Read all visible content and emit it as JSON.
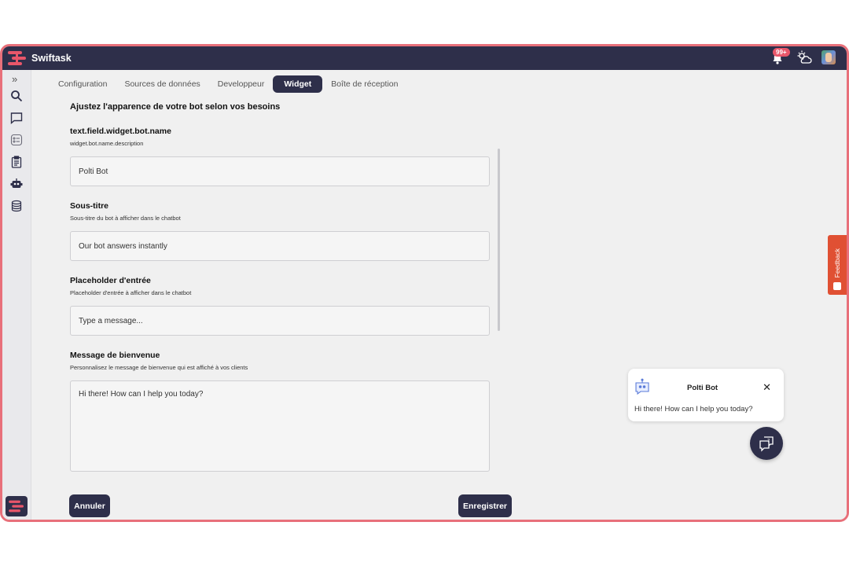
{
  "app": {
    "name": "Swiftask",
    "notification_count": "99+"
  },
  "colors": {
    "primary": "#2e2f4a",
    "accent": "#e8566a",
    "feedback": "#e05033",
    "frame": "#e8707a"
  },
  "sidebar": {
    "expand_glyph": "»",
    "icons": [
      "search-icon",
      "chat-icon",
      "checklist-icon",
      "clipboard-icon",
      "robot-icon",
      "database-icon"
    ]
  },
  "tabs": [
    {
      "label": "Configuration",
      "active": false
    },
    {
      "label": "Sources de données",
      "active": false
    },
    {
      "label": "Developpeur",
      "active": false
    },
    {
      "label": "Widget",
      "active": true
    },
    {
      "label": "Boîte de réception",
      "active": false
    }
  ],
  "form": {
    "title": "Ajustez l'apparence de votre bot selon vos besoins",
    "fields": [
      {
        "label": "text.field.widget.bot.name",
        "description": "widget.bot.name.description",
        "value": "Polti Bot"
      },
      {
        "label": "Sous-titre",
        "description": "Sous-titre du bot à afficher dans le chatbot",
        "value": "Our bot answers instantly"
      },
      {
        "label": "Placeholder d'entrée",
        "description": "Placeholder d'entrée à afficher dans le chatbot",
        "placeholder": "Type a message..."
      },
      {
        "label": "Message de bienvenue",
        "description": "Personnalisez le message de bienvenue qui est affiché à vos clients",
        "value": "Hi there! How can I help you today?"
      }
    ],
    "cancel_label": "Annuler",
    "save_label": "Enregistrer"
  },
  "feedback": {
    "label": "Feedback"
  },
  "chat_preview": {
    "bot_name": "Polti Bot",
    "close_glyph": "✕",
    "message": "Hi there! How can I help you today?"
  }
}
